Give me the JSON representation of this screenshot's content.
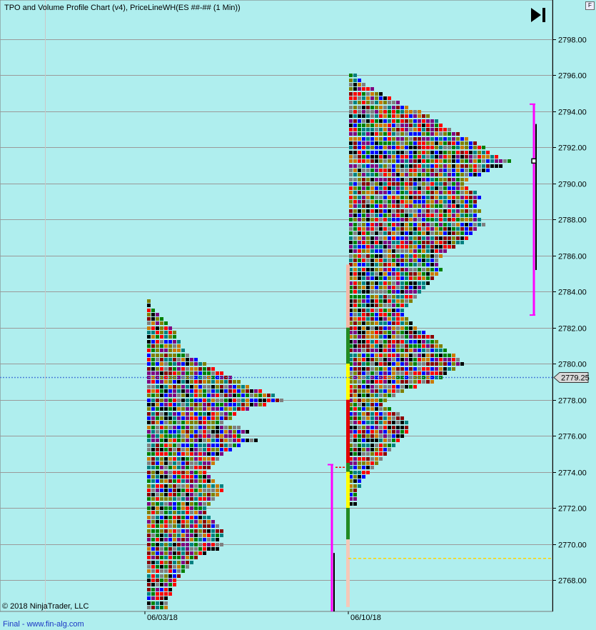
{
  "title": "TPO and Volume Profile Chart (v4), PriceLineWH(ES ##-## (1 Min))",
  "copyright": "© 2018 NinjaTrader, LLC",
  "footer": "Final - www.fin-alg.com",
  "corner_button": "F",
  "last_price_label": "2779.25",
  "colors": {
    "background": "#afeeee",
    "grid": "#9a9a9a",
    "last_price": "#4a7fd8",
    "value_area_bar": "#ff00ff",
    "tpo_palette": [
      "#800080",
      "#ff0000",
      "#008000",
      "#0000ff",
      "#808000",
      "#000000",
      "#cc7a00",
      "#808080",
      "#8b0000",
      "#008080"
    ]
  },
  "icons": {
    "jump_to_end": "skip-to-end-icon"
  },
  "chart_data": {
    "type": "tpo-market-profile",
    "title": "TPO and Volume Profile Chart (v4), PriceLineWH(ES ##-## (1 Min))",
    "xlabel": "",
    "ylabel": "",
    "ylim": [
      2766.5,
      2799.0
    ],
    "y_ticks": [
      2798.0,
      2796.0,
      2794.0,
      2792.0,
      2790.0,
      2788.0,
      2786.0,
      2784.0,
      2782.0,
      2780.0,
      2778.0,
      2776.0,
      2774.0,
      2772.0,
      2770.0,
      2768.0
    ],
    "y_tick_labels": [
      "2798.00",
      "2796.00",
      "2794.00",
      "2792.00",
      "2790.00",
      "2788.00",
      "2786.00",
      "2784.00",
      "2782.00",
      "2780.00",
      "2778.00",
      "2776.00",
      "2774.00",
      "2772.00",
      "2770.00",
      "2768.00"
    ],
    "tick_size": 0.25,
    "x_labels": [
      "06/03/18",
      "06/10/18"
    ],
    "last_price": 2779.25,
    "grid": true,
    "profiles": [
      {
        "session": "06/03/18",
        "high": 2783.5,
        "low": 2766.5,
        "poc": 2778.0,
        "widths": [
          [
            2783.5,
            1
          ],
          [
            2783.25,
            1
          ],
          [
            2783.0,
            2
          ],
          [
            2782.75,
            3
          ],
          [
            2782.5,
            4
          ],
          [
            2782.25,
            5
          ],
          [
            2782.0,
            6
          ],
          [
            2781.75,
            7
          ],
          [
            2781.5,
            7
          ],
          [
            2781.25,
            8
          ],
          [
            2781.0,
            8
          ],
          [
            2780.75,
            9
          ],
          [
            2780.5,
            10
          ],
          [
            2780.25,
            12
          ],
          [
            2780.0,
            14
          ],
          [
            2779.75,
            16
          ],
          [
            2779.5,
            18
          ],
          [
            2779.25,
            20
          ],
          [
            2779.0,
            22
          ],
          [
            2778.75,
            24
          ],
          [
            2778.5,
            27
          ],
          [
            2778.25,
            30
          ],
          [
            2778.0,
            32
          ],
          [
            2777.75,
            28
          ],
          [
            2777.5,
            24
          ],
          [
            2777.25,
            21
          ],
          [
            2777.0,
            20
          ],
          [
            2776.75,
            18
          ],
          [
            2776.5,
            22
          ],
          [
            2776.25,
            24
          ],
          [
            2776.0,
            22
          ],
          [
            2775.75,
            26
          ],
          [
            2775.5,
            22
          ],
          [
            2775.25,
            20
          ],
          [
            2775.0,
            18
          ],
          [
            2774.75,
            17
          ],
          [
            2774.5,
            16
          ],
          [
            2774.25,
            15
          ],
          [
            2774.0,
            14
          ],
          [
            2773.75,
            15
          ],
          [
            2773.5,
            16
          ],
          [
            2773.25,
            18
          ],
          [
            2773.0,
            18
          ],
          [
            2772.75,
            17
          ],
          [
            2772.5,
            16
          ],
          [
            2772.25,
            15
          ],
          [
            2772.0,
            14
          ],
          [
            2771.75,
            14
          ],
          [
            2771.5,
            15
          ],
          [
            2771.25,
            16
          ],
          [
            2771.0,
            17
          ],
          [
            2770.75,
            18
          ],
          [
            2770.5,
            18
          ],
          [
            2770.25,
            17
          ],
          [
            2770.0,
            18
          ],
          [
            2769.75,
            17
          ],
          [
            2769.5,
            14
          ],
          [
            2769.25,
            12
          ],
          [
            2769.0,
            11
          ],
          [
            2768.75,
            10
          ],
          [
            2768.5,
            9
          ],
          [
            2768.25,
            8
          ],
          [
            2768.0,
            7
          ],
          [
            2767.75,
            7
          ],
          [
            2767.5,
            6
          ],
          [
            2767.25,
            6
          ],
          [
            2767.0,
            5
          ],
          [
            2766.75,
            5
          ],
          [
            2766.5,
            5
          ]
        ]
      },
      {
        "session": "06/10/18",
        "high": 2796.0,
        "low": 2772.25,
        "poc": 2791.25,
        "widths": [
          [
            2796.0,
            2
          ],
          [
            2795.75,
            3
          ],
          [
            2795.5,
            4
          ],
          [
            2795.25,
            6
          ],
          [
            2795.0,
            8
          ],
          [
            2794.75,
            10
          ],
          [
            2794.5,
            12
          ],
          [
            2794.25,
            14
          ],
          [
            2794.0,
            17
          ],
          [
            2793.75,
            19
          ],
          [
            2793.5,
            21
          ],
          [
            2793.25,
            22
          ],
          [
            2793.0,
            24
          ],
          [
            2792.75,
            26
          ],
          [
            2792.5,
            28
          ],
          [
            2792.25,
            30
          ],
          [
            2792.0,
            32
          ],
          [
            2791.75,
            33
          ],
          [
            2791.5,
            35
          ],
          [
            2791.25,
            38
          ],
          [
            2791.0,
            36
          ],
          [
            2790.75,
            33
          ],
          [
            2790.5,
            31
          ],
          [
            2790.25,
            28
          ],
          [
            2790.0,
            27
          ],
          [
            2789.75,
            28
          ],
          [
            2789.5,
            30
          ],
          [
            2789.25,
            31
          ],
          [
            2789.0,
            30
          ],
          [
            2788.75,
            30
          ],
          [
            2788.5,
            31
          ],
          [
            2788.25,
            30
          ],
          [
            2788.0,
            31
          ],
          [
            2787.75,
            32
          ],
          [
            2787.5,
            30
          ],
          [
            2787.25,
            29
          ],
          [
            2787.0,
            28
          ],
          [
            2786.75,
            27
          ],
          [
            2786.5,
            25
          ],
          [
            2786.25,
            23
          ],
          [
            2786.0,
            22
          ],
          [
            2785.75,
            21
          ],
          [
            2785.5,
            21
          ],
          [
            2785.25,
            22
          ],
          [
            2785.0,
            21
          ],
          [
            2784.75,
            20
          ],
          [
            2784.5,
            19
          ],
          [
            2784.25,
            18
          ],
          [
            2784.0,
            17
          ],
          [
            2783.75,
            16
          ],
          [
            2783.5,
            15
          ],
          [
            2783.25,
            14
          ],
          [
            2783.0,
            13
          ],
          [
            2782.75,
            13
          ],
          [
            2782.5,
            14
          ],
          [
            2782.25,
            15
          ],
          [
            2782.0,
            16
          ],
          [
            2781.75,
            18
          ],
          [
            2781.5,
            20
          ],
          [
            2781.25,
            21
          ],
          [
            2781.0,
            22
          ],
          [
            2780.75,
            23
          ],
          [
            2780.5,
            25
          ],
          [
            2780.25,
            26
          ],
          [
            2780.0,
            27
          ],
          [
            2779.75,
            25
          ],
          [
            2779.5,
            23
          ],
          [
            2779.25,
            22
          ],
          [
            2779.0,
            20
          ],
          [
            2778.75,
            16
          ],
          [
            2778.5,
            13
          ],
          [
            2778.25,
            11
          ],
          [
            2778.0,
            9
          ],
          [
            2777.75,
            8
          ],
          [
            2777.5,
            10
          ],
          [
            2777.25,
            12
          ],
          [
            2777.0,
            13
          ],
          [
            2776.75,
            14
          ],
          [
            2776.5,
            14
          ],
          [
            2776.25,
            14
          ],
          [
            2776.0,
            13
          ],
          [
            2775.75,
            12
          ],
          [
            2775.5,
            11
          ],
          [
            2775.25,
            10
          ],
          [
            2775.0,
            9
          ],
          [
            2774.75,
            8
          ],
          [
            2774.5,
            7
          ],
          [
            2774.25,
            6
          ],
          [
            2774.0,
            5
          ],
          [
            2773.75,
            4
          ],
          [
            2773.5,
            3
          ],
          [
            2773.25,
            3
          ],
          [
            2773.0,
            2
          ],
          [
            2772.75,
            2
          ],
          [
            2772.5,
            2
          ],
          [
            2772.25,
            2
          ]
        ]
      }
    ]
  }
}
